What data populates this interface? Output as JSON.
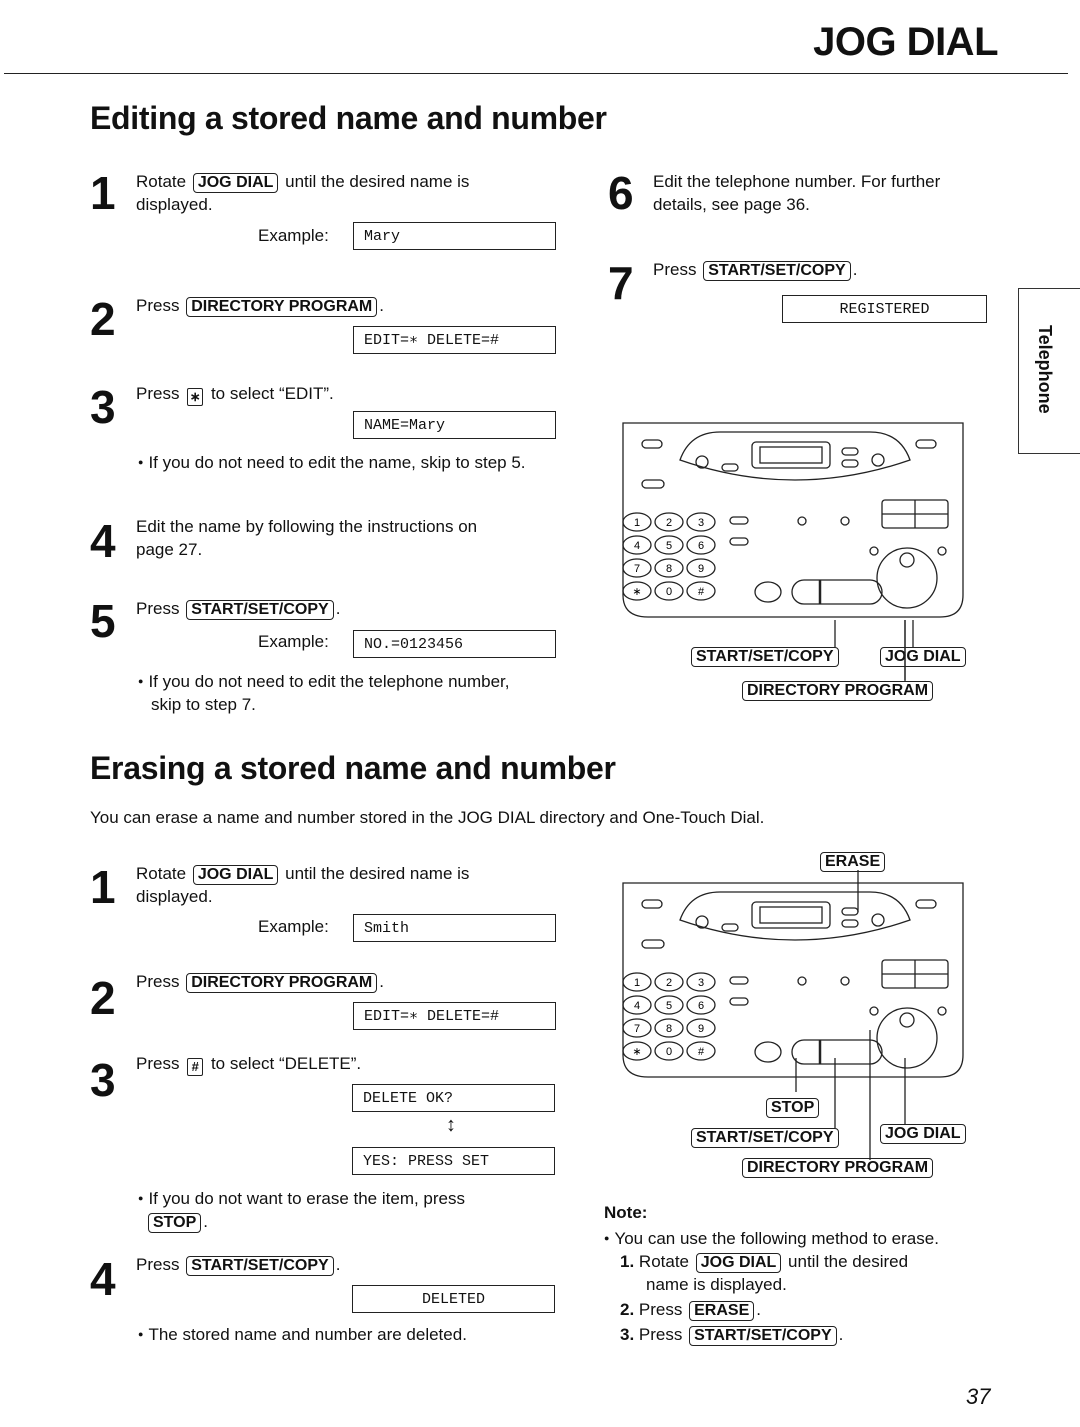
{
  "header": {
    "title": "JOG DIAL"
  },
  "side_tab": {
    "label": "Telephone"
  },
  "editing": {
    "heading": "Editing a stored name and number",
    "steps": [
      {
        "num": "1",
        "pre": "Rotate",
        "key": "JOG DIAL",
        "post": "until the desired name is",
        "line2": "displayed.",
        "example_label": "Example:",
        "lcd": "Mary"
      },
      {
        "num": "2",
        "pre": "Press",
        "key": "DIRECTORY PROGRAM",
        "post": ".",
        "lcd": "EDIT=∗ DELETE=#"
      },
      {
        "num": "3",
        "pre": "Press",
        "key": "∗",
        "post": "to select “EDIT”.",
        "lcd": "NAME=Mary",
        "bullet": "If you do not need to edit the name, skip to step 5."
      },
      {
        "num": "4",
        "text": "Edit the name by following the instructions on",
        "line2": "page 27."
      },
      {
        "num": "5",
        "pre": "Press",
        "key": "START/SET/COPY",
        "post": ".",
        "example_label": "Example:",
        "lcd": "NO.=0123456",
        "bullet": "If you do not need to edit the telephone number,",
        "bullet_line2": "skip to step 7."
      },
      {
        "num": "6",
        "text": "Edit the telephone number. For further",
        "line2": "details, see page 36."
      },
      {
        "num": "7",
        "pre": "Press",
        "key": "START/SET/COPY",
        "post": ".",
        "lcd": "REGISTERED"
      }
    ],
    "diagram_labels": {
      "start": "START/SET/COPY",
      "jog": "JOG DIAL",
      "directory": "DIRECTORY PROGRAM"
    }
  },
  "erasing": {
    "heading": "Erasing a stored name and number",
    "intro": "You can erase a name and number stored in the JOG DIAL directory and One-Touch Dial.",
    "steps": [
      {
        "num": "1",
        "pre": "Rotate",
        "key": "JOG DIAL",
        "post": "until the desired name is",
        "line2": "displayed.",
        "example_label": "Example:",
        "lcd": "Smith"
      },
      {
        "num": "2",
        "pre": "Press",
        "key": "DIRECTORY PROGRAM",
        "post": ".",
        "lcd": "EDIT=∗ DELETE=#"
      },
      {
        "num": "3",
        "pre": "Press",
        "key": "#",
        "post": "to select “DELETE”.",
        "lcd": "DELETE OK?",
        "lcd_alt": "YES: PRESS SET",
        "arrow": "↕",
        "bullet": "If you do not want to erase the item, press",
        "bullet_key": "STOP"
      },
      {
        "num": "4",
        "pre": "Press",
        "key": "START/SET/COPY",
        "post": ".",
        "lcd": "DELETED",
        "bullet": "The stored name and number are deleted."
      }
    ],
    "diagram_labels": {
      "erase": "ERASE",
      "stop": "STOP",
      "start": "START/SET/COPY",
      "jog": "JOG DIAL",
      "directory": "DIRECTORY PROGRAM"
    },
    "note": {
      "title": "Note:",
      "bullet": "You can use the following method to erase.",
      "items": [
        {
          "n": "1.",
          "pre": "Rotate",
          "key": "JOG DIAL",
          "post": "until the desired",
          "line2": "name is displayed."
        },
        {
          "n": "2.",
          "pre": "Press",
          "key": "ERASE",
          "post": "."
        },
        {
          "n": "3.",
          "pre": "Press",
          "key": "START/SET/COPY",
          "post": "."
        }
      ]
    }
  },
  "keypad": [
    "1",
    "2",
    "3",
    "4",
    "5",
    "6",
    "7",
    "8",
    "9",
    "∗",
    "0",
    "#"
  ],
  "footer": {
    "page_number": "37"
  }
}
